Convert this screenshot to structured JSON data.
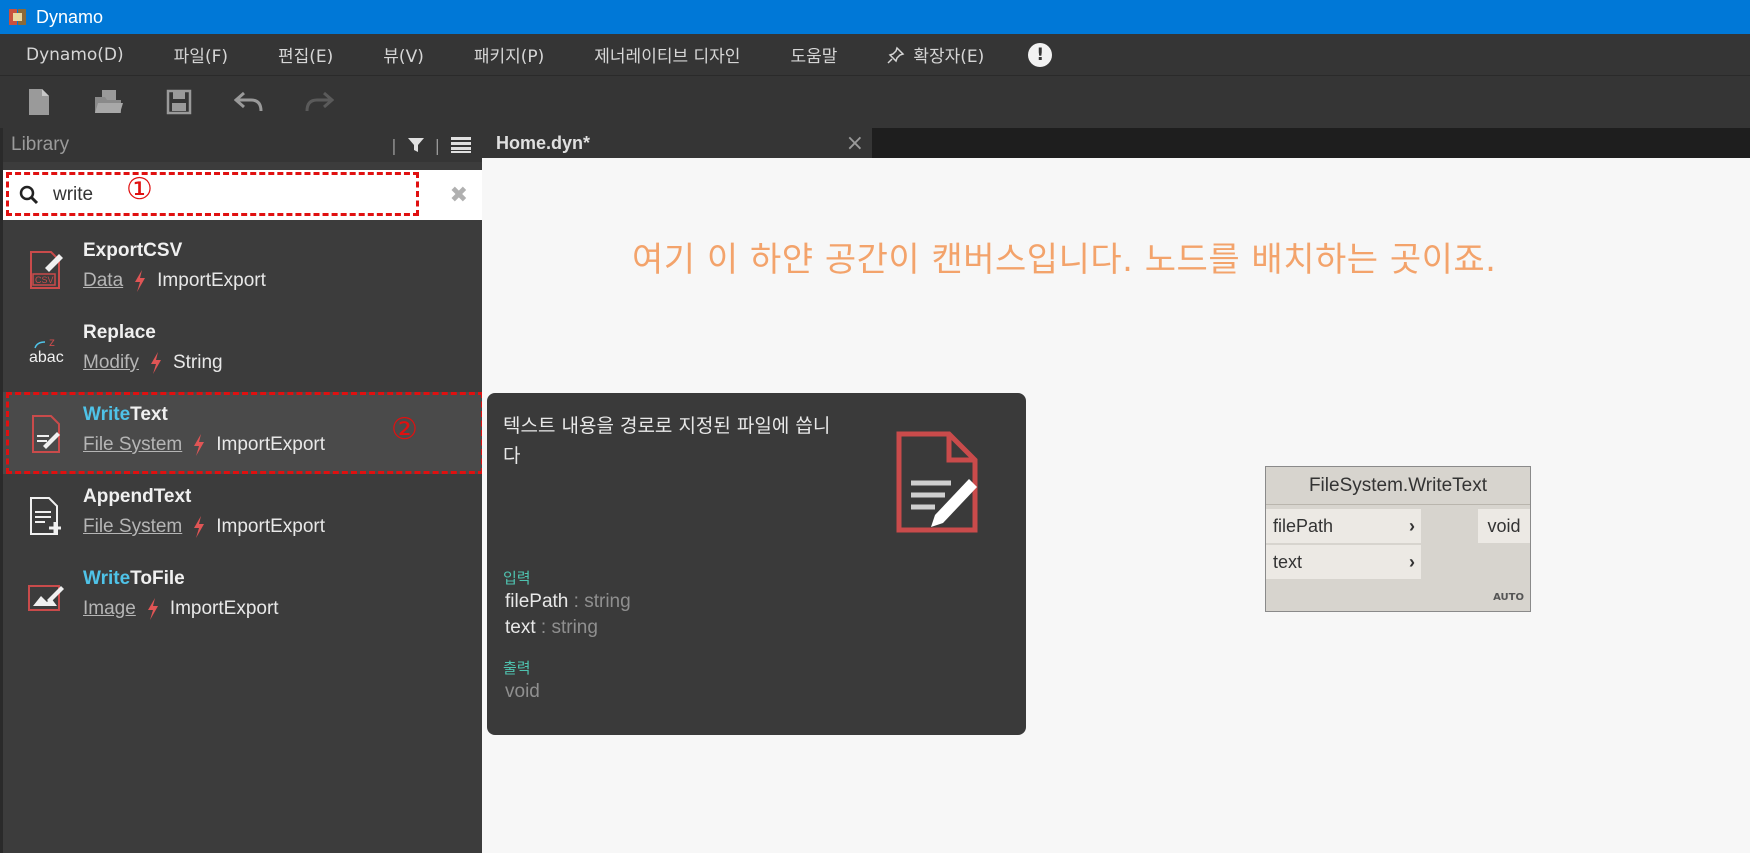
{
  "window": {
    "title": "Dynamo"
  },
  "menu": {
    "items": [
      "Dynamo(D)",
      "파일(F)",
      "편집(E)",
      "뷰(V)",
      "패키지(P)",
      "제너레이티브 디자인",
      "도움말"
    ],
    "extensions": "확장자(E)",
    "alert": "!"
  },
  "library": {
    "title": "Library",
    "sep": "|",
    "search": {
      "value": "write",
      "marker": "①"
    },
    "selected_marker": "②",
    "results": [
      {
        "pre": "",
        "hl": "",
        "post": "ExportCSV",
        "category": "Data",
        "group": "ImportExport"
      },
      {
        "pre": "",
        "hl": "",
        "post": "Replace",
        "category": "Modify",
        "group": "String"
      },
      {
        "pre": "",
        "hl": "Write",
        "post": "Text",
        "category": "File System",
        "group": "ImportExport"
      },
      {
        "pre": "",
        "hl": "",
        "post": "AppendText",
        "category": "File System",
        "group": "ImportExport"
      },
      {
        "pre": "",
        "hl": "Write",
        "post": "ToFile",
        "category": "Image",
        "group": "ImportExport"
      }
    ]
  },
  "tab": {
    "label": "Home.dyn*",
    "close": "×"
  },
  "canvas": {
    "annotation": "여기 이 하얀 공간이 캔버스입니다. 노드를 배치하는 곳이죠."
  },
  "tooltip": {
    "description": "텍스트 내용을 경로로 지정된 파일에 씁니다",
    "inputs_label": "입력",
    "inputs": [
      {
        "name": "filePath",
        "type": " : string"
      },
      {
        "name": "text",
        "type": " : string"
      }
    ],
    "outputs_label": "출력",
    "output": "void"
  },
  "node": {
    "title": "FileSystem.WriteText",
    "inputs": [
      "filePath",
      "text"
    ],
    "output": "void",
    "lacing": "AUTO"
  },
  "colors": {
    "highlight": "#4fc3e8",
    "accent": "#e01010",
    "titlebar": "#0078d7"
  }
}
